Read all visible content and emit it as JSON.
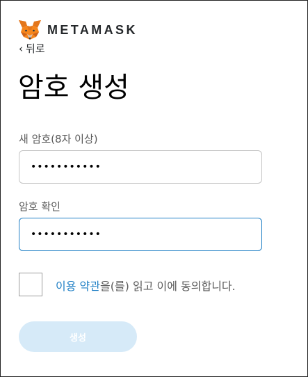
{
  "brand": {
    "wordmark": "METAMASK"
  },
  "nav": {
    "back_label": "뒤로"
  },
  "page": {
    "title": "암호 생성"
  },
  "form": {
    "new_password": {
      "label": "새 암호(8자 이상)",
      "value": "•••••••••••"
    },
    "confirm_password": {
      "label": "암호 확인",
      "value": "•••••••••••"
    },
    "terms": {
      "checked": false,
      "link_text": "이용 약관",
      "suffix_text": "을(를) 읽고 이에 동의합니다."
    },
    "submit_label": "생성"
  },
  "colors": {
    "accent": "#1f7fc5",
    "button_disabled_bg": "#d6eaf8",
    "text_muted": "#5a5a5a"
  }
}
